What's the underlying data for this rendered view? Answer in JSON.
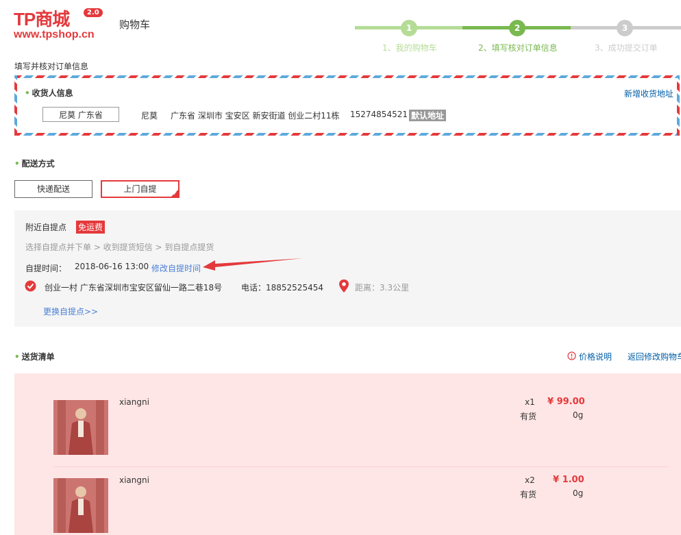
{
  "header": {
    "logo_text": "TP商城",
    "logo_badge": "2.0",
    "logo_url": "www.tpshop.cn",
    "page_title": "购物车"
  },
  "steps": [
    {
      "num": "1",
      "label": "1、我的购物车",
      "color": "#b4dc96"
    },
    {
      "num": "2",
      "label": "2、填写核对订单信息",
      "color": "#7ab950"
    },
    {
      "num": "3",
      "label": "3、成功提交订单",
      "color": "#cccccc"
    }
  ],
  "order_heading": "填写并核对订单信息",
  "consignee": {
    "title": "收货人信息",
    "add_link": "新增收货地址",
    "chip": "尼莫 广东省",
    "name": "尼莫",
    "address": "广东省 深圳市 宝安区 新安街道 创业二村11栋",
    "phone": "15274854521",
    "default_badge": "默认地址"
  },
  "shipping": {
    "title": "配送方式",
    "options": [
      "快递配送",
      "上门自提"
    ],
    "selected": "上门自提"
  },
  "pickup": {
    "title": "附近自提点",
    "free_badge": "免运费",
    "steps_text": "选择自提点并下单 > 收到提货短信 > 到自提点提货",
    "time_label": "自提时间：",
    "time_value": "2018-06-16 13:00",
    "modify_link": "修改自提时间",
    "point_name": "创业一村 广东省深圳市宝安区留仙一路二巷18号",
    "phone": "电话：18852525454",
    "distance": "距离：3.3公里",
    "change_link": "更换自提点>>"
  },
  "delivery_list": {
    "title": "送货清单",
    "price_note": "价格说明",
    "back_link": "返回修改购物车"
  },
  "items": [
    {
      "name": "xiangni",
      "qty": "x1",
      "price": "¥ 99.00",
      "stock": "有货",
      "weight": "0g"
    },
    {
      "name": "xiangni",
      "qty": "x2",
      "price": "¥ 1.00",
      "stock": "有货",
      "weight": "0g"
    }
  ],
  "colors": {
    "brand_red": "#e4393c",
    "step_green": "#7ab950",
    "link_blue": "#005ea7"
  }
}
